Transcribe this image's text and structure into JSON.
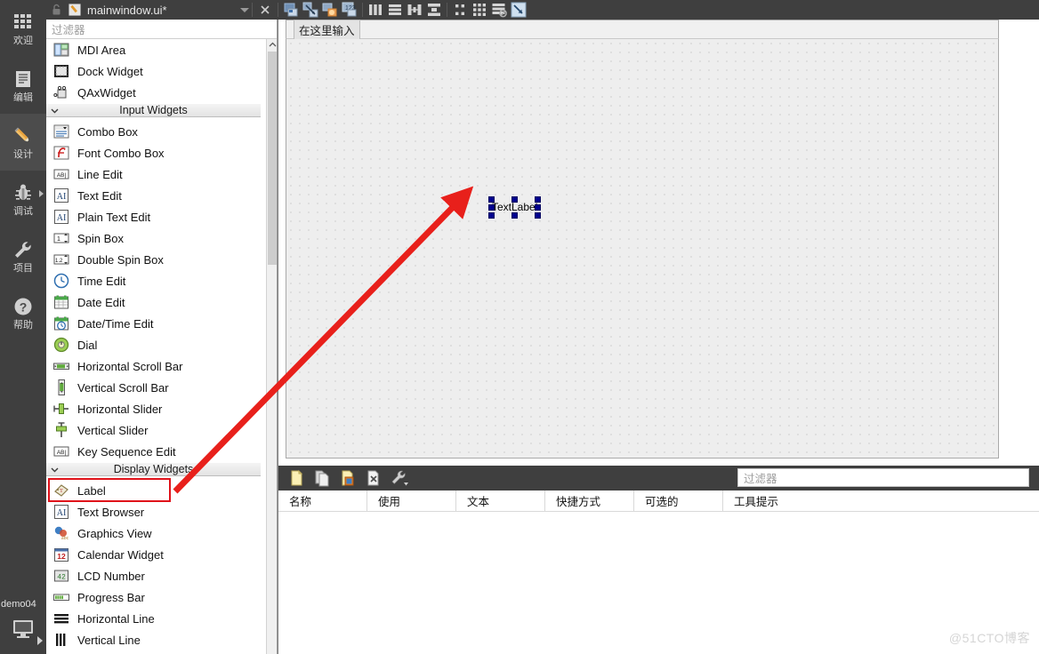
{
  "window": {
    "title": "mainwindow.ui*",
    "lock_icon": "lock-icon",
    "file_icon": "ui-file-icon",
    "dropdown_icon": "chevron-down-icon"
  },
  "modebar": {
    "items": [
      {
        "label": "欢迎",
        "icon": "grid-welcome-icon",
        "active": false,
        "arrow": false
      },
      {
        "label": "编辑",
        "icon": "document-edit-icon",
        "active": false,
        "arrow": false
      },
      {
        "label": "设计",
        "icon": "pencil-design-icon",
        "active": true,
        "arrow": false
      },
      {
        "label": "调试",
        "icon": "bug-debug-icon",
        "active": false,
        "arrow": true
      },
      {
        "label": "项目",
        "icon": "wrench-projects-icon",
        "active": false,
        "arrow": false
      },
      {
        "label": "帮助",
        "icon": "question-help-icon",
        "active": false,
        "arrow": false
      }
    ],
    "run_target": {
      "project": "demo04",
      "icon": "monitor-kit-icon",
      "arrow_icon": "chevron-right-icon"
    }
  },
  "toolbar": {
    "buttons": [
      {
        "name": "close-editor-button",
        "icon": "close-x-icon"
      },
      {
        "name": "edit-widgets-button",
        "icon": "edit-widgets-icon"
      },
      {
        "name": "edit-signals-slots-button",
        "icon": "signals-slots-icon"
      },
      {
        "name": "edit-buddies-button",
        "icon": "buddies-icon"
      },
      {
        "name": "edit-tab-order-button",
        "icon": "tab-order-icon"
      },
      {
        "name": "layout-horizontally-button",
        "icon": "layout-horizontal-icon"
      },
      {
        "name": "layout-vertically-button",
        "icon": "layout-vertical-icon"
      },
      {
        "name": "layout-in-splitter-h-button",
        "icon": "splitter-horizontal-icon"
      },
      {
        "name": "layout-in-splitter-v-button",
        "icon": "splitter-vertical-icon"
      },
      {
        "name": "layout-in-form-button",
        "icon": "form-layout-icon"
      },
      {
        "name": "layout-in-grid-button",
        "icon": "grid-layout-icon"
      },
      {
        "name": "break-layout-button",
        "icon": "break-layout-icon"
      },
      {
        "name": "adjust-size-button",
        "icon": "adjust-size-icon"
      }
    ]
  },
  "palette": {
    "filter_placeholder": "过滤器",
    "scrollbar": {
      "up_icon": "chevron-up-icon",
      "down_icon": "chevron-down-icon"
    },
    "highlighted_item": "Label",
    "items": [
      {
        "type": "widget",
        "label": "MDI Area",
        "icon": "mdi-area-icon"
      },
      {
        "type": "widget",
        "label": "Dock Widget",
        "icon": "dock-widget-icon"
      },
      {
        "type": "widget",
        "label": "QAxWidget",
        "icon": "qax-widget-icon"
      },
      {
        "type": "category",
        "label": "Input Widgets",
        "icon": "chevron-down-icon"
      },
      {
        "type": "widget",
        "label": "Combo Box",
        "icon": "combo-box-icon"
      },
      {
        "type": "widget",
        "label": "Font Combo Box",
        "icon": "font-combo-box-icon"
      },
      {
        "type": "widget",
        "label": "Line Edit",
        "icon": "line-edit-icon"
      },
      {
        "type": "widget",
        "label": "Text Edit",
        "icon": "text-edit-icon"
      },
      {
        "type": "widget",
        "label": "Plain Text Edit",
        "icon": "plain-text-edit-icon"
      },
      {
        "type": "widget",
        "label": "Spin Box",
        "icon": "spin-box-icon"
      },
      {
        "type": "widget",
        "label": "Double Spin Box",
        "icon": "double-spin-box-icon"
      },
      {
        "type": "widget",
        "label": "Time Edit",
        "icon": "time-edit-icon"
      },
      {
        "type": "widget",
        "label": "Date Edit",
        "icon": "date-edit-icon"
      },
      {
        "type": "widget",
        "label": "Date/Time Edit",
        "icon": "date-time-edit-icon"
      },
      {
        "type": "widget",
        "label": "Dial",
        "icon": "dial-icon"
      },
      {
        "type": "widget",
        "label": "Horizontal Scroll Bar",
        "icon": "h-scrollbar-icon"
      },
      {
        "type": "widget",
        "label": "Vertical Scroll Bar",
        "icon": "v-scrollbar-icon"
      },
      {
        "type": "widget",
        "label": "Horizontal Slider",
        "icon": "h-slider-icon"
      },
      {
        "type": "widget",
        "label": "Vertical Slider",
        "icon": "v-slider-icon"
      },
      {
        "type": "widget",
        "label": "Key Sequence Edit",
        "icon": "key-sequence-edit-icon"
      },
      {
        "type": "category",
        "label": "Display Widgets",
        "icon": "chevron-down-icon"
      },
      {
        "type": "widget",
        "label": "Label",
        "icon": "label-icon"
      },
      {
        "type": "widget",
        "label": "Text Browser",
        "icon": "text-browser-icon"
      },
      {
        "type": "widget",
        "label": "Graphics View",
        "icon": "graphics-view-icon"
      },
      {
        "type": "widget",
        "label": "Calendar Widget",
        "icon": "calendar-widget-icon"
      },
      {
        "type": "widget",
        "label": "LCD Number",
        "icon": "lcd-number-icon"
      },
      {
        "type": "widget",
        "label": "Progress Bar",
        "icon": "progress-bar-icon"
      },
      {
        "type": "widget",
        "label": "Horizontal Line",
        "icon": "horizontal-line-icon"
      },
      {
        "type": "widget",
        "label": "Vertical Line",
        "icon": "vertical-line-icon"
      }
    ]
  },
  "designer": {
    "menubar_placeholder": "在这里输入",
    "selected_widget": {
      "text": "TextLabel",
      "handle_count": 8
    }
  },
  "action_editor": {
    "toolbar": [
      {
        "name": "new-action-button",
        "icon": "new-file-icon"
      },
      {
        "name": "copy-action-button",
        "icon": "copy-file-icon"
      },
      {
        "name": "paste-action-button",
        "icon": "paste-file-icon"
      },
      {
        "name": "delete-action-button",
        "icon": "delete-file-icon"
      },
      {
        "name": "configure-button",
        "icon": "wrench-icon"
      }
    ],
    "filter_placeholder": "过滤器",
    "columns": [
      "名称",
      "使用",
      "文本",
      "快捷方式",
      "可选的",
      "工具提示"
    ],
    "rows": []
  },
  "annotations": {
    "arrow_color": "#e8201b",
    "box_color": "#e0121a",
    "watermark": "@51CTO博客"
  }
}
